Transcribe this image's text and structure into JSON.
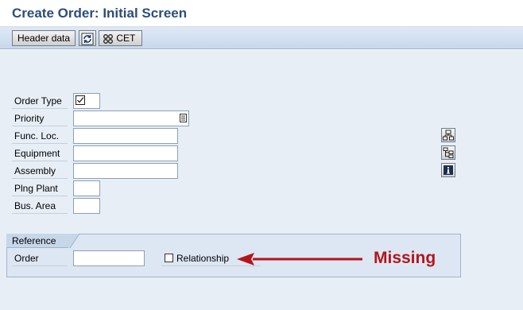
{
  "title": "Create Order: Initial Screen",
  "toolbar": {
    "header_data_label": "Header data",
    "cet_label": "CET"
  },
  "fields": [
    {
      "label": "Order Type"
    },
    {
      "label": "Priority"
    },
    {
      "label": "Func. Loc."
    },
    {
      "label": "Equipment"
    },
    {
      "label": "Assembly"
    },
    {
      "label": "Plng Plant"
    },
    {
      "label": "Bus. Area"
    }
  ],
  "reference": {
    "title": "Reference",
    "order_label": "Order",
    "relationship_label": "Relationship"
  },
  "annotation": {
    "text": "Missing",
    "color": "#b3151b"
  },
  "colors": {
    "title": "#2a4e7a",
    "toolbar_bg": "#c7d8ec",
    "screen_bg": "#e8eef6"
  }
}
